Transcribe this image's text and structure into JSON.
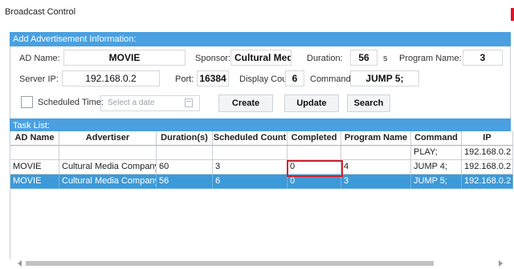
{
  "window": {
    "title": "Broadcast Control"
  },
  "ad_info": {
    "header": "Add Advertisement Information:",
    "ad_name_label": "AD Name:",
    "ad_name_value": "MOVIE",
    "sponsor_label": "Sponsor:",
    "sponsor_value": "Cultural Media",
    "duration_label": "Duration:",
    "duration_value": "56",
    "duration_unit": "s",
    "program_name_label": "Program Name:",
    "program_name_value": "3",
    "server_ip_label": "Server IP:",
    "server_ip_value": "192.168.0.2",
    "port_label": "Port:",
    "port_value": "16384",
    "display_count_label": "Display Count:",
    "display_count_value": "6",
    "command_label": "Command:",
    "command_value": "JUMP 5;",
    "scheduled_time_label": "Scheduled Time:",
    "date_placeholder": "Select a date",
    "create_label": "Create",
    "update_label": "Update",
    "search_label": "Search"
  },
  "task_list": {
    "header": "Task List:",
    "columns": [
      "AD Name",
      "Advertiser",
      "Duration(s)",
      "Scheduled Count",
      "Completed",
      "Program Name",
      "Command",
      "IP"
    ],
    "rows": [
      [
        "",
        "",
        "",
        "",
        "",
        "",
        "PLAY;",
        "192.168.0.2"
      ],
      [
        "MOVIE",
        "Cultural Media Company",
        "60",
        "3",
        "0",
        "4",
        "JUMP 4;",
        "192.168.0.2"
      ],
      [
        "MOVIE",
        "Cultural Media Company",
        "56",
        "6",
        "0",
        "3",
        "JUMP 5;",
        "192.168.0.2"
      ]
    ],
    "selected_row": 2
  },
  "colors": {
    "header_blue": "#4aa0e0",
    "selection_blue": "#3d9ad8",
    "highlight_red": "#d0202a",
    "close_red": "#e81123"
  }
}
